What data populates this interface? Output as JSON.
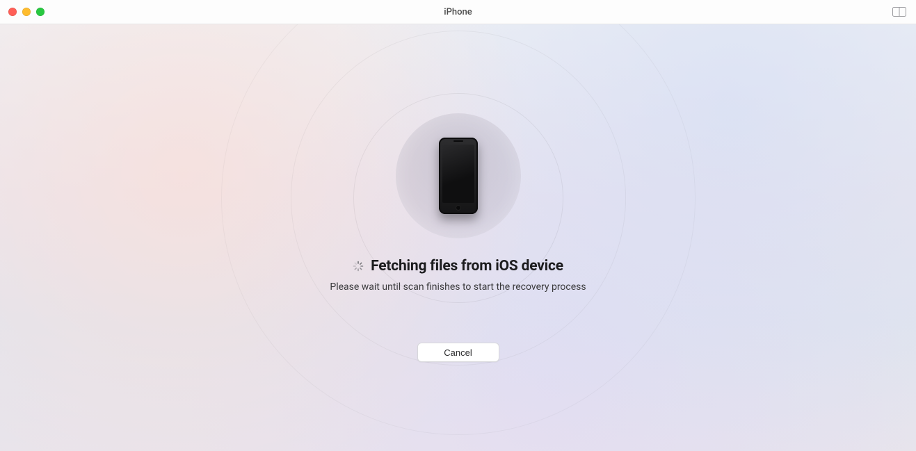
{
  "window": {
    "title": "iPhone"
  },
  "titlebar": {
    "close_icon": "close-icon",
    "minimize_icon": "minimize-icon",
    "zoom_icon": "zoom-icon",
    "view_button_icon": "split-view-icon"
  },
  "main": {
    "device_icon": "iphone-device-icon",
    "spinner_icon": "spinner-icon",
    "heading": "Fetching files from iOS device",
    "subtext": "Please wait until scan finishes to start the recovery process",
    "cancel_label": "Cancel"
  }
}
